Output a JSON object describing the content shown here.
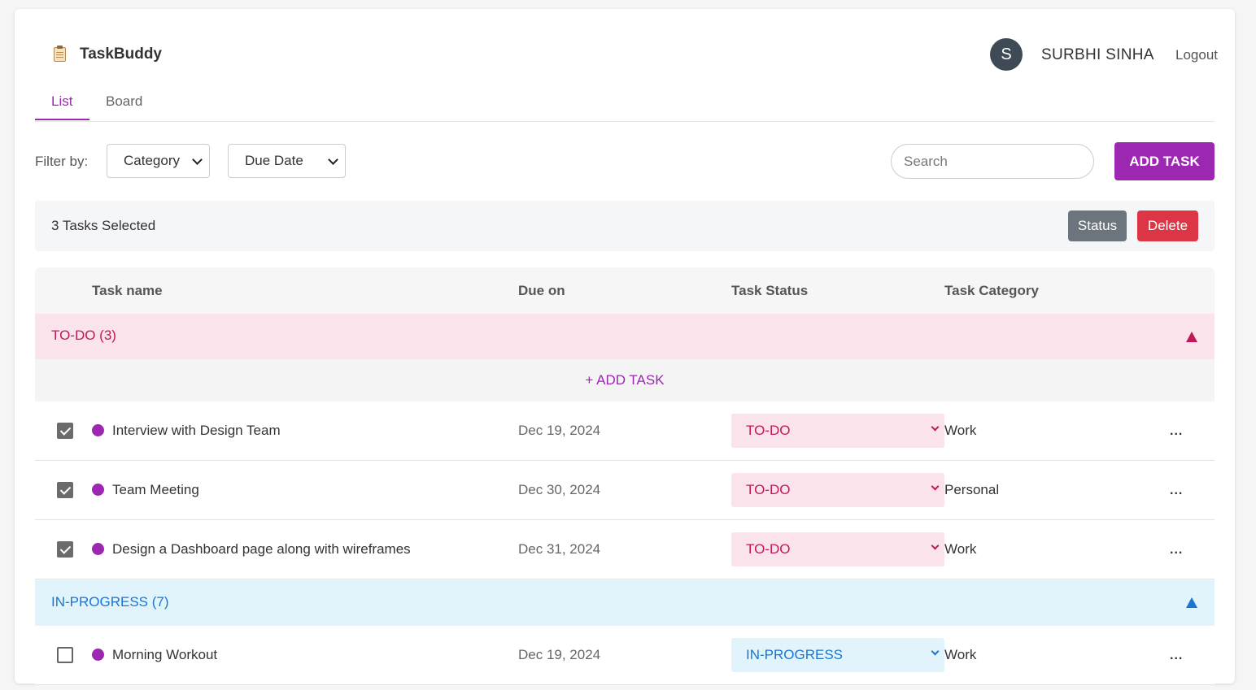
{
  "app": {
    "name": "TaskBuddy",
    "logo_icon": "clipboard-icon"
  },
  "user": {
    "avatar_initial": "S",
    "name": "SURBHI SINHA",
    "logout_label": "Logout"
  },
  "tabs": [
    {
      "label": "List",
      "active": true
    },
    {
      "label": "Board",
      "active": false
    }
  ],
  "filters": {
    "label": "Filter by:",
    "category": {
      "selected": "Category"
    },
    "due_date": {
      "selected": "Due Date"
    }
  },
  "search": {
    "placeholder": "Search",
    "value": ""
  },
  "toolbar": {
    "add_task_label": "ADD TASK"
  },
  "selection": {
    "text": "3 Tasks Selected",
    "status_label": "Status",
    "delete_label": "Delete"
  },
  "table": {
    "columns": [
      "Task name",
      "Due on",
      "Task Status",
      "Task Category"
    ],
    "add_task_inline_label": "+ ADD TASK",
    "groups": [
      {
        "label": "TO-DO (3)",
        "color": "#c2185b",
        "background": "#fae3ea",
        "rows": [
          {
            "checked": true,
            "name": "Interview with Design Team",
            "due": "Dec 19, 2024",
            "status": "TO-DO",
            "category": "Work",
            "more": "..."
          },
          {
            "checked": true,
            "name": "Team Meeting",
            "due": "Dec 30, 2024",
            "status": "TO-DO",
            "category": "Personal",
            "more": "..."
          },
          {
            "checked": true,
            "name": "Design a Dashboard page along with wireframes",
            "due": "Dec 31, 2024",
            "status": "TO-DO",
            "category": "Work",
            "more": "..."
          }
        ]
      },
      {
        "label": "IN-PROGRESS (7)",
        "color": "#1976d2",
        "background": "#e1f3fb",
        "rows": [
          {
            "checked": false,
            "name": "Morning Workout",
            "due": "Dec 19, 2024",
            "status": "IN-PROGRESS",
            "category": "Work",
            "more": "..."
          }
        ]
      }
    ]
  },
  "colors": {
    "accent": "#9c27b0",
    "danger": "#dc3545",
    "secondary": "#6c757d"
  }
}
